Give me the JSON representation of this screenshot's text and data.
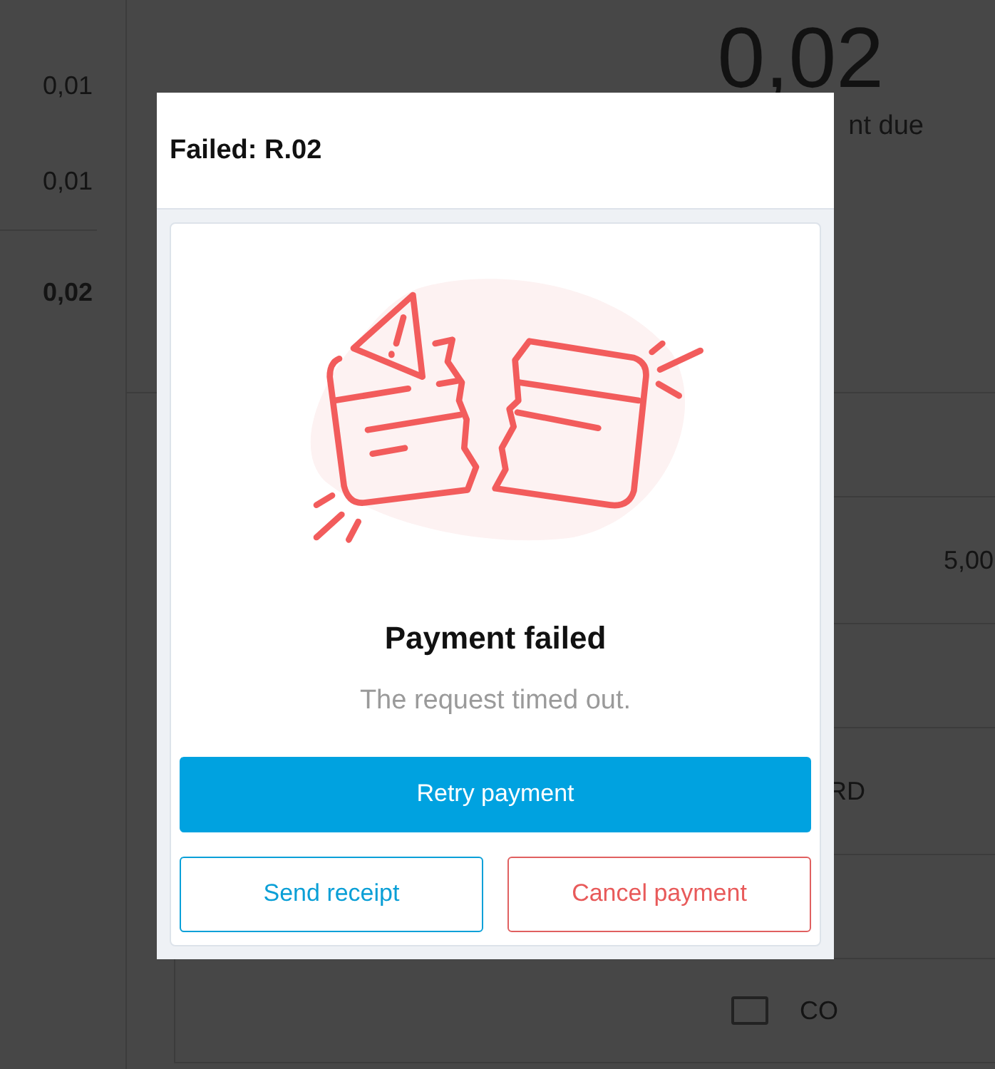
{
  "background": {
    "summary_rows": [
      "0,01",
      "0,01"
    ],
    "summary_total": "0,02",
    "amount": "0,02",
    "amount_label": "nt due",
    "list_cells": [
      {
        "kind": "spacer"
      },
      {
        "kind": "amount",
        "text": "5,00"
      },
      {
        "kind": "spacer"
      },
      {
        "kind": "label",
        "text": "RD"
      },
      {
        "kind": "spacer"
      },
      {
        "kind": "checkbox",
        "text": "CO",
        "checked": false
      }
    ]
  },
  "dialog": {
    "title": "Failed: R.02",
    "heading": "Payment failed",
    "message": "The request timed out.",
    "buttons": [
      {
        "kind": "primary",
        "label": "Retry payment"
      },
      {
        "kind": "outline",
        "label": "Send receipt"
      },
      {
        "kind": "danger",
        "label": "Cancel payment"
      }
    ]
  }
}
